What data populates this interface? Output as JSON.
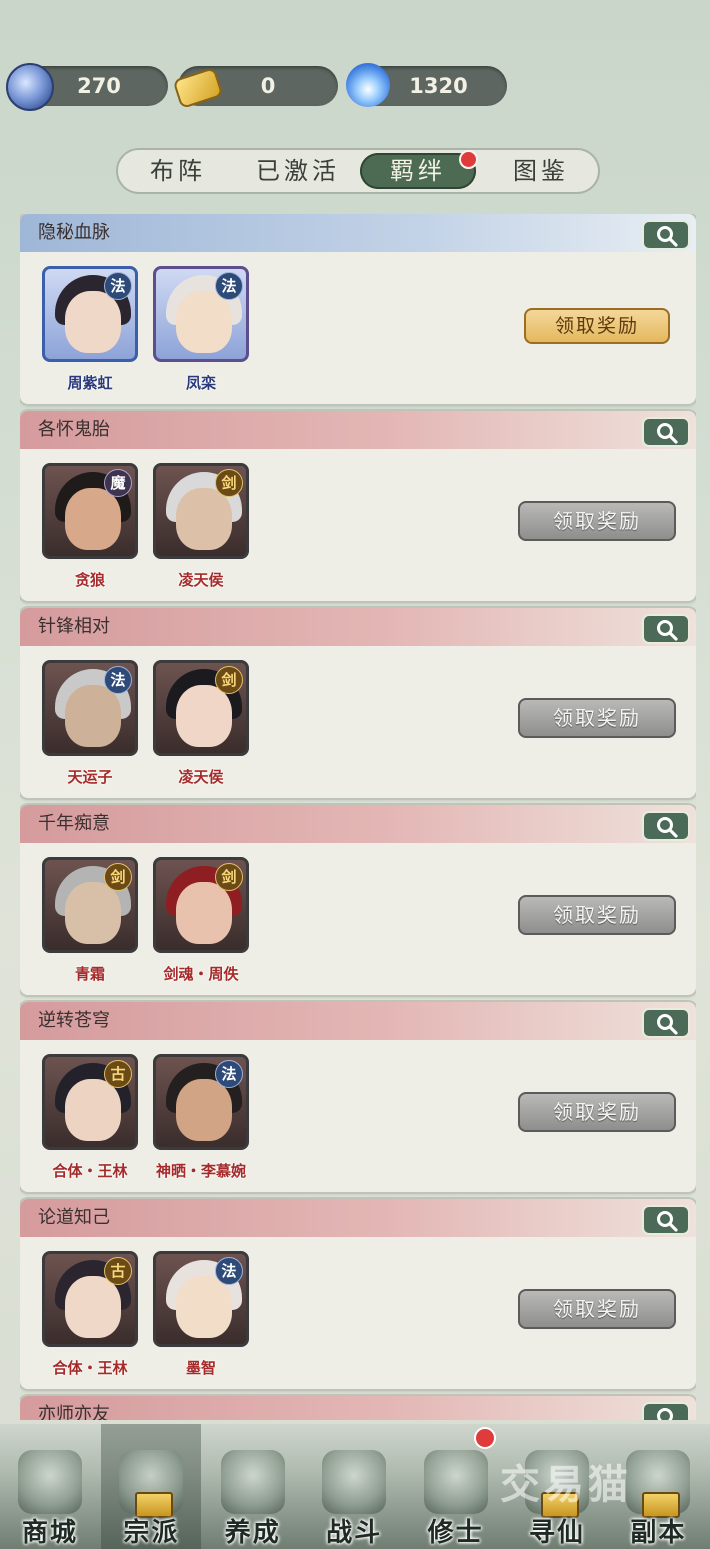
{
  "resources": [
    {
      "icon": "spirit-stone-icon",
      "value": "270"
    },
    {
      "icon": "gold-ingot-icon",
      "value": "0"
    },
    {
      "icon": "blue-flame-icon",
      "value": "1320"
    }
  ],
  "tabs": [
    {
      "label": "布阵",
      "active": false
    },
    {
      "label": "已激活",
      "active": false
    },
    {
      "label": "羁绊",
      "active": true,
      "badge": true
    },
    {
      "label": "图鉴",
      "active": false
    }
  ],
  "bonds": [
    {
      "title": "隐秘血脉",
      "header": "blue",
      "heroes": [
        {
          "name": "周紫虹",
          "badge": "法"
        },
        {
          "name": "凤栾",
          "badge": "法"
        }
      ],
      "button": "领取奖励",
      "button_state": "available"
    },
    {
      "title": "各怀鬼胎",
      "header": "red",
      "heroes": [
        {
          "name": "贪狼",
          "badge": "魔"
        },
        {
          "name": "凌天侯",
          "badge": "剑"
        }
      ],
      "button": "领取奖励",
      "button_state": "disabled"
    },
    {
      "title": "针锋相对",
      "header": "red",
      "heroes": [
        {
          "name": "天运子",
          "badge": "法"
        },
        {
          "name": "凌天侯",
          "badge": "剑"
        }
      ],
      "button": "领取奖励",
      "button_state": "disabled"
    },
    {
      "title": "千年痴意",
      "header": "red",
      "heroes": [
        {
          "name": "青霜",
          "badge": "剑"
        },
        {
          "name": "剑魂・周佚",
          "badge": "剑"
        }
      ],
      "button": "领取奖励",
      "button_state": "disabled"
    },
    {
      "title": "逆转苍穹",
      "header": "red",
      "heroes": [
        {
          "name": "合体・王林",
          "badge": "古"
        },
        {
          "name": "神晒・李慕婉",
          "badge": "法"
        }
      ],
      "button": "领取奖励",
      "button_state": "disabled"
    },
    {
      "title": "论道知己",
      "header": "red",
      "heroes": [
        {
          "name": "合体・王林",
          "badge": "古"
        },
        {
          "name": "墨智",
          "badge": "法"
        }
      ],
      "button": "领取奖励",
      "button_state": "disabled"
    },
    {
      "title": "亦师亦友",
      "header": "red",
      "heroes": [],
      "button": "",
      "button_state": "hidden"
    }
  ],
  "nav": [
    {
      "label": "商城",
      "icon": "pavilion-icon",
      "locked": false
    },
    {
      "label": "宗派",
      "icon": "temple-icon",
      "locked": true
    },
    {
      "label": "养成",
      "icon": "gourd-icon",
      "locked": false
    },
    {
      "label": "战斗",
      "icon": "battle-icon",
      "locked": false
    },
    {
      "label": "修士",
      "icon": "cultivator-icon",
      "locked": false,
      "badge": true
    },
    {
      "label": "寻仙",
      "icon": "immortal-icon",
      "locked": true
    },
    {
      "label": "副本",
      "icon": "dungeon-icon",
      "locked": true
    }
  ],
  "watermark": "交易猫",
  "colors": {
    "tab_active": "#4d6a52",
    "badge_red": "#e03b3b",
    "btn_gold": "#e4b85e",
    "btn_gray": "#8e8e8c",
    "name_red": "#a52b2b"
  }
}
